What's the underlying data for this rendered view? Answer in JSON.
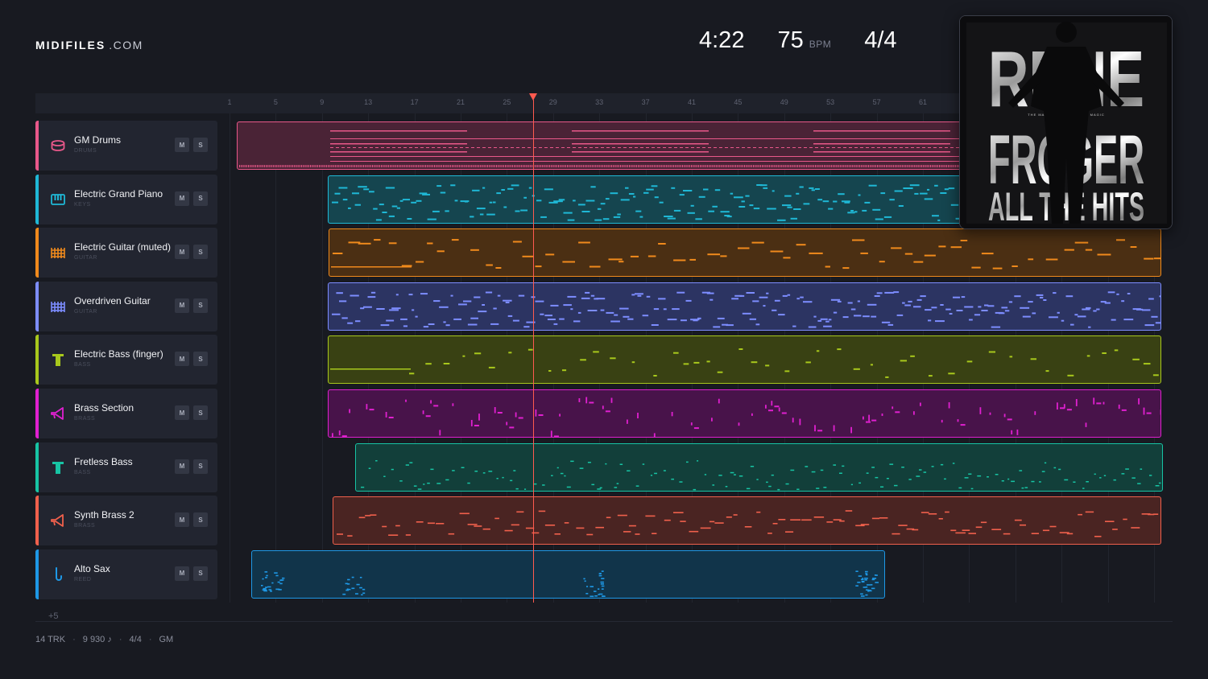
{
  "brand": {
    "name": "MIDIFILES",
    "tld": ".COM"
  },
  "transport": {
    "time": "4:22",
    "tempo": "75",
    "tempo_unit": "BPM",
    "time_signature": "4/4"
  },
  "ruler": {
    "ticks": [
      "1",
      "5",
      "9",
      "13",
      "17",
      "21",
      "25",
      "29",
      "33",
      "37",
      "41",
      "45",
      "49",
      "53",
      "57",
      "61"
    ]
  },
  "playhead_bar": 27.3,
  "tracks": [
    {
      "name": "GM Drums",
      "category": "DRUMS",
      "color": "#e9588a",
      "fill": "#4a2336",
      "icon": "drum-icon",
      "mute": "M",
      "solo": "S",
      "clip_start_bar": 1.6,
      "clip_end_bar": 77,
      "style": "drums"
    },
    {
      "name": "Electric Grand Piano",
      "category": "KEYS",
      "color": "#1fb8d6",
      "fill": "#15454f",
      "icon": "piano-icon",
      "mute": "M",
      "solo": "S",
      "clip_start_bar": 9.5,
      "clip_end_bar": 77,
      "style": "dense"
    },
    {
      "name": "Electric Guitar (muted)",
      "category": "GUITAR",
      "color": "#f08a1c",
      "fill": "#4b2f13",
      "icon": "guitar-grid-icon",
      "mute": "M",
      "solo": "S",
      "clip_start_bar": 9.6,
      "clip_end_bar": 81.6,
      "style": "sparse"
    },
    {
      "name": "Overdriven Guitar",
      "category": "GUITAR",
      "color": "#7d8dff",
      "fill": "#2c3462",
      "icon": "guitar-grid-icon",
      "mute": "M",
      "solo": "S",
      "clip_start_bar": 9.5,
      "clip_end_bar": 81.6,
      "style": "dense"
    },
    {
      "name": "Electric Bass (finger)",
      "category": "BASS",
      "color": "#a8c81c",
      "fill": "#394113",
      "icon": "bass-icon",
      "mute": "M",
      "solo": "S",
      "clip_start_bar": 9.5,
      "clip_end_bar": 81.6,
      "style": "bass"
    },
    {
      "name": "Brass Section",
      "category": "BRASS",
      "color": "#e020d0",
      "fill": "#48134a",
      "icon": "horn-icon",
      "mute": "M",
      "solo": "S",
      "clip_start_bar": 9.5,
      "clip_end_bar": 81.6,
      "style": "stabs"
    },
    {
      "name": "Fretless Bass",
      "category": "BASS",
      "color": "#17c4a4",
      "fill": "#123f3a",
      "icon": "bass-icon",
      "mute": "M",
      "solo": "S",
      "clip_start_bar": 11.9,
      "clip_end_bar": 81.8,
      "style": "scatter"
    },
    {
      "name": "Synth Brass 2",
      "category": "BRASS",
      "color": "#f0604c",
      "fill": "#4a2422",
      "icon": "horn-icon",
      "mute": "M",
      "solo": "S",
      "clip_start_bar": 9.9,
      "clip_end_bar": 81.6,
      "style": "blocks"
    },
    {
      "name": "Alto Sax",
      "category": "REED",
      "color": "#1e98e6",
      "fill": "#11344a",
      "icon": "sax-icon",
      "mute": "M",
      "solo": "S",
      "clip_start_bar": 2.9,
      "clip_end_bar": 57.7,
      "style": "sax"
    }
  ],
  "more_tracks": "+5",
  "footer": {
    "tracks": "14 TRK",
    "notes": "9 930 ♪",
    "signature": "4/4",
    "standard": "GM"
  },
  "cover": {
    "line1": "RENE",
    "line2": "FROGER",
    "line3": "ALL THE HITS",
    "tagline": "THE MAN. THE MUSIC. THE MAGIC",
    "logo_text": ""
  }
}
